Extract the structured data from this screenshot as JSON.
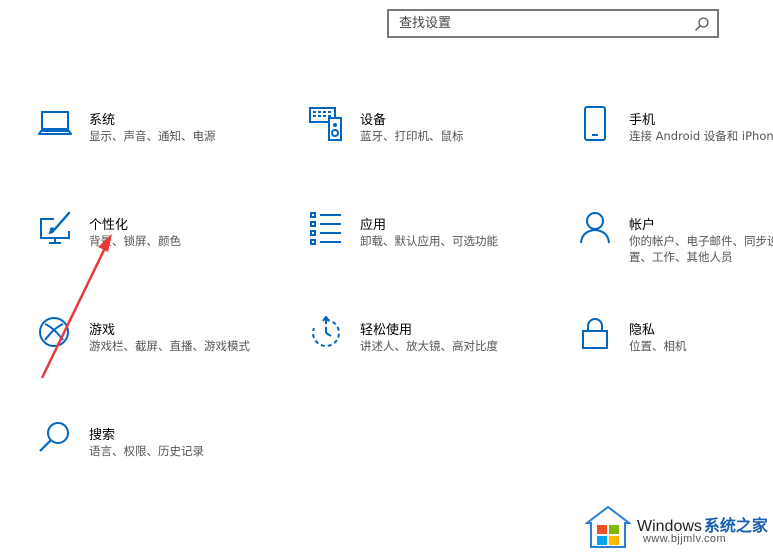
{
  "search": {
    "placeholder": "查找设置"
  },
  "accent_color": "#0067c0",
  "tiles": [
    {
      "title": "系统",
      "desc": "显示、声音、通知、电源",
      "icon": "laptop-icon"
    },
    {
      "title": "设备",
      "desc": "蓝牙、打印机、鼠标",
      "icon": "devices-icon"
    },
    {
      "title": "手机",
      "desc": "连接 Android 设备和 iPhone",
      "icon": "phone-icon"
    },
    {
      "title": "个性化",
      "desc": "背景、锁屏、颜色",
      "icon": "personalization-icon"
    },
    {
      "title": "应用",
      "desc": "卸载、默认应用、可选功能",
      "icon": "apps-icon"
    },
    {
      "title": "帐户",
      "desc": "你的帐户、电子邮件、同步设置、工作、其他人员",
      "icon": "account-icon"
    },
    {
      "title": "游戏",
      "desc": "游戏栏、截屏、直播、游戏模式",
      "icon": "xbox-icon"
    },
    {
      "title": "轻松使用",
      "desc": "讲述人、放大镜、高对比度",
      "icon": "ease-of-access-icon"
    },
    {
      "title": "隐私",
      "desc": "位置、相机",
      "icon": "lock-icon"
    },
    {
      "title": "搜索",
      "desc": "语言、权限、历史记录",
      "icon": "search-icon"
    }
  ],
  "watermark": {
    "brand": "Windows",
    "site": "系统之家",
    "url": "www.bjjmlv.com"
  }
}
